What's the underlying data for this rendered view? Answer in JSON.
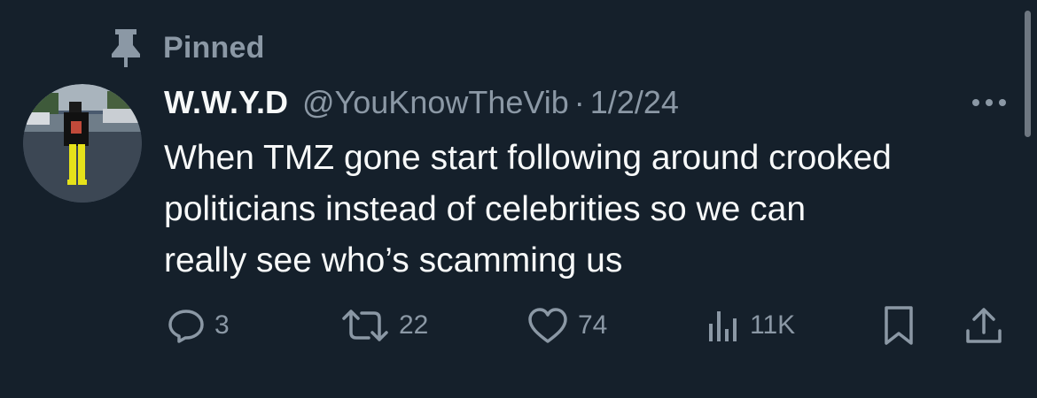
{
  "pinned": {
    "label": "Pinned",
    "icon": "pin-icon"
  },
  "tweet": {
    "display_name": "W.W.Y.D",
    "handle": "@YouKnowTheVib",
    "separator": "·",
    "date": "1/2/24",
    "text": "When TMZ gone start following around crooked\npoliticians instead of celebrities so we can\nreally see who’s scamming us"
  },
  "actions": {
    "reply": {
      "icon": "reply-icon",
      "count": "3"
    },
    "retweet": {
      "icon": "retweet-icon",
      "count": "22"
    },
    "like": {
      "icon": "heart-icon",
      "count": "74"
    },
    "views": {
      "icon": "views-icon",
      "count": "11K"
    },
    "bookmark": {
      "icon": "bookmark-icon"
    },
    "share": {
      "icon": "share-icon"
    }
  },
  "colors": {
    "background": "#15202b",
    "text_primary": "#f7f9f9",
    "text_secondary": "#8b98a5"
  }
}
